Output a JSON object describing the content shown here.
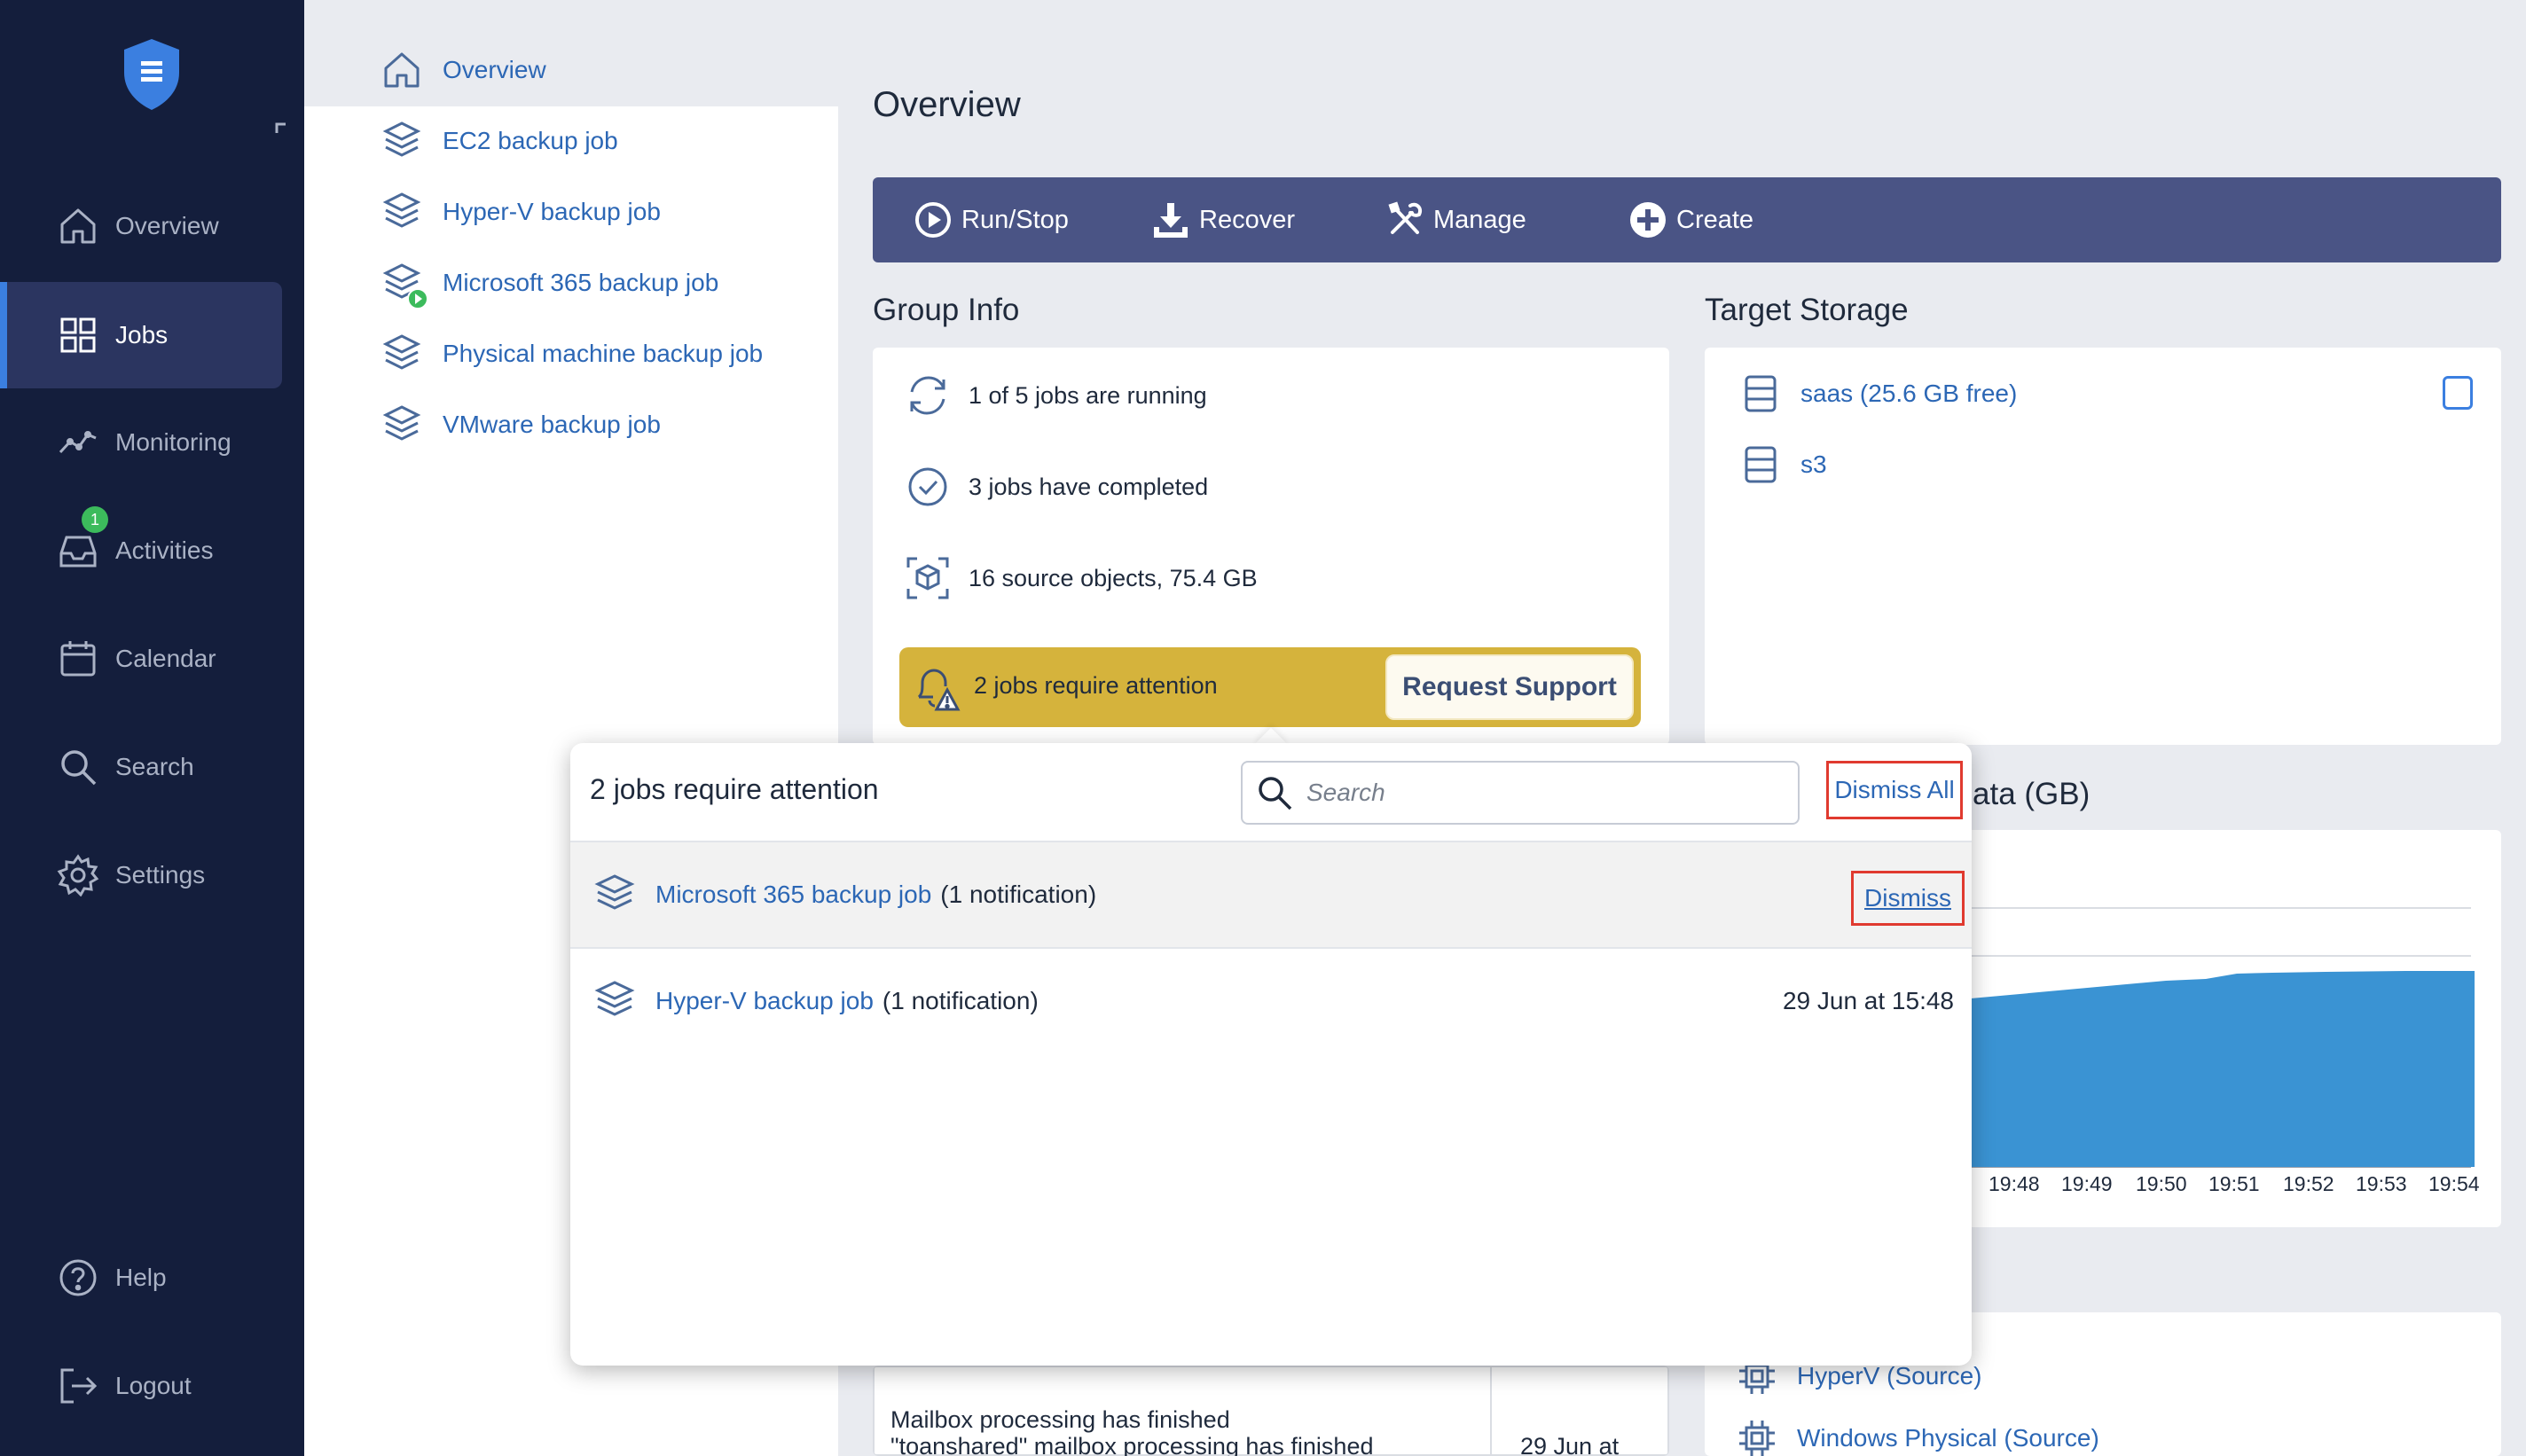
{
  "sidebar": {
    "items": [
      {
        "label": "Overview",
        "icon": "home-icon"
      },
      {
        "label": "Jobs",
        "icon": "grid-icon"
      },
      {
        "label": "Monitoring",
        "icon": "chart-line-icon"
      },
      {
        "label": "Activities",
        "icon": "inbox-icon",
        "badge": "1"
      },
      {
        "label": "Calendar",
        "icon": "calendar-icon"
      },
      {
        "label": "Search",
        "icon": "search-icon"
      },
      {
        "label": "Settings",
        "icon": "gear-icon"
      }
    ],
    "help_label": "Help",
    "logout_label": "Logout"
  },
  "job_list": {
    "items": [
      {
        "label": "Overview"
      },
      {
        "label": "EC2 backup job"
      },
      {
        "label": "Hyper-V backup job"
      },
      {
        "label": "Microsoft 365 backup job",
        "running": true
      },
      {
        "label": "Physical machine backup job"
      },
      {
        "label": "VMware backup job"
      }
    ]
  },
  "main": {
    "title": "Overview",
    "toolbar": {
      "run_stop": "Run/Stop",
      "recover": "Recover",
      "manage": "Manage",
      "create": "Create"
    },
    "group_info": {
      "title": "Group Info",
      "running": "1 of 5 jobs are running",
      "completed": "3 jobs have completed",
      "source_objects": "16 source objects, 75.4 GB",
      "attention": "2 jobs require attention",
      "request_support": "Request Support"
    },
    "target_storage": {
      "title": "Target Storage",
      "items": [
        "saas (25.6 GB free)",
        "s3"
      ]
    },
    "chart": {
      "title_fragment": "ata (GB)",
      "ticks": [
        "19:48",
        "19:49",
        "19:50",
        "19:51",
        "19:52",
        "19:53",
        "19:54"
      ]
    },
    "sources": [
      "HyperV (Source)",
      "Windows Physical (Source)"
    ],
    "event": {
      "message_line1": "Mailbox processing has finished",
      "message_line2": "\"toanshared\" mailbox processing has finished",
      "time": "29 Jun at"
    }
  },
  "popup": {
    "title": "2 jobs require attention",
    "search_placeholder": "Search",
    "dismiss_all": "Dismiss All",
    "rows": [
      {
        "job": "Microsoft 365 backup job",
        "count": "(1 notification)",
        "action": "Dismiss"
      },
      {
        "job": "Hyper-V backup job",
        "count": "(1 notification)",
        "time": "29 Jun at 15:48"
      }
    ]
  },
  "colors": {
    "sidebar_bg": "#141e3c",
    "toolbar_bg": "#4a5485",
    "link": "#2c67b5",
    "attention": "#d5b33c",
    "chart_fill": "#3a93d3",
    "highlight_box": "#e03a2f"
  }
}
